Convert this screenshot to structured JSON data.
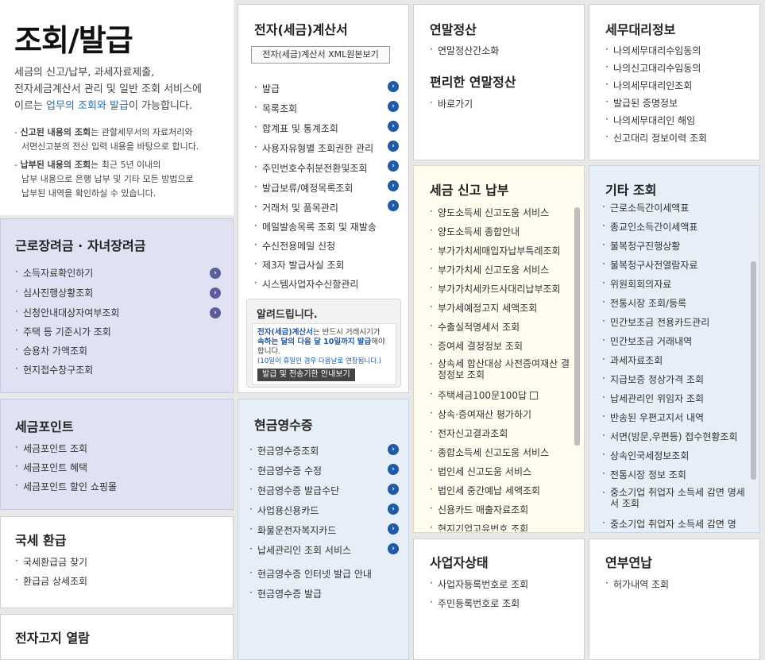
{
  "intro": {
    "title": "조회/발급",
    "desc_lines": [
      "세금의 신고/납부, 과세자료제출,",
      "전자세금계산서 관리 및 일반 조회 서비스에",
      "이르는 "
    ],
    "desc_link": "업무의 조회와 발급",
    "desc_tail": "이 가능합니다.",
    "note1_bold": "신고된 내용의 조회",
    "note1_rest": "는 관할세무서의 자료처리와",
    "note1_line2": "서면신고분의 전산 입력 내용을 바탕으로 합니다.",
    "note2_bold": "납부된 내용의 조회",
    "note2_rest": "는 최근 5년 이내의",
    "note2_line2": "납부 내용으로 은행 납부 및 기타 모든 방법으로",
    "note2_line3": "납부된 내역을 확인하실 수 있습니다."
  },
  "labor": {
    "title": "근로장려금 · 자녀장려금",
    "items": [
      "소득자료확인하기",
      "심사진행상황조회",
      "신청안내대상자여부조회",
      "주택 등 기준시가 조회",
      "승용차 가액조회",
      "현지접수창구조회"
    ]
  },
  "point": {
    "title": "세금포인트",
    "items": [
      "세금포인트 조회",
      "세금포인트 혜택",
      "세금포인트 할인 쇼핑몰"
    ]
  },
  "refund": {
    "title": "국세 환급",
    "items": [
      "국세환급금 찾기",
      "환급금 상세조회"
    ]
  },
  "notice": {
    "title": "전자고지 열람"
  },
  "invoice": {
    "title": "전자(세금)계산서",
    "xml_button": "전자(세금)계산서 XML원본보기",
    "items": [
      "발급",
      "목록조회",
      "합계표 및 통계조회",
      "사용자유형별 조회권한 관리",
      "주민번호수취분전환및조회",
      "발급보류/예정목록조회",
      "거래처 및 품목관리",
      "메일발송목록 조회 및 재발송",
      "수신전용메일 신청",
      "제3자 발급사실 조회",
      "시스템사업자수신함관리"
    ],
    "alert_title": "알려드립니다.",
    "alert_text1": "전자(세금)계산서",
    "alert_text2": "는 반드시 거래시기가",
    "alert_text3": "속하는 달의 다음 달 10일까지 발급",
    "alert_text4": "해야",
    "alert_text5": "합니다.",
    "alert_small": "(10일이 휴일인 경우 다음날로 연장됩니다.)",
    "alert_button": "발급 및 전송기한 안내보기"
  },
  "cash": {
    "title": "현금영수증",
    "items": [
      "현금영수증조회",
      "현금영수증 수정",
      "현금영수증 발급수단",
      "사업용신용카드",
      "화물운전자복지카드",
      "납세관리인 조회 서비스",
      "현금영수증 인터넷 발급 안내",
      "현금영수증 발급"
    ]
  },
  "yearend": {
    "title": "연말정산",
    "items": [
      "연말정산간소화"
    ],
    "title2": "편리한 연말정산",
    "items2": [
      "바로가기"
    ]
  },
  "taxfile": {
    "title": "세금 신고 납부",
    "items": [
      "양도소득세 신고도움 서비스",
      "양도소득세 종합안내",
      "부가가치세매입자납부특례조회",
      "부가가치세 신고도움 서비스",
      "부가가치세카드사대리납부조회",
      "부가세예정고지 세액조회",
      "수출실적명세서 조회",
      "증여세 결정정보 조회",
      "상속세 합산대상 사전증여재산 결정정보 조회",
      "주택세금100문100답",
      "상속·증여재산 평가하기",
      "전자신고결과조회",
      "종합소득세 신고도움 서비스",
      "법인세 신고도움 서비스",
      "법인세 중간예납 세액조회",
      "신용카드 매출자료조회",
      "현지기업고유번호 조회"
    ]
  },
  "biz": {
    "title": "사업자상태",
    "items": [
      "사업자등록번호로 조회",
      "주민등록번호로 조회"
    ]
  },
  "agent": {
    "title": "세무대리정보",
    "items": [
      "나의세무대리수임동의",
      "나의신고대리수임동의",
      "나의세무대리인조회",
      "발급된 증명정보",
      "나의세무대리인 해임",
      "신고대리 정보이력 조회"
    ]
  },
  "other": {
    "title": "기타 조회",
    "items": [
      "근로소득간이세액표",
      "종교인소득간이세액표",
      "불복청구진행상황",
      "불복청구사전열람자료",
      "위원회회의자료",
      "전통시장 조회/등록",
      "민간보조금 전용카드관리",
      "민간보조금 거래내역",
      "과세자료조회",
      "지급보증 정상가격 조회",
      "납세관리인 위임자 조회",
      "반송된 우편고지서 내역",
      "서면(방문,우편등) 접수현황조회",
      "상속인국세정보조회",
      "전통시장 정보 조회",
      "중소기업 취업자 소득세 감면 명세서 조회",
      "중소기업 취업자 소득세 감면 명"
    ]
  },
  "pension": {
    "title": "연부연납",
    "items": [
      "허가내역 조회"
    ]
  },
  "colors": {
    "purple_bg": "#e1e1f4",
    "blue_bg": "#e6eef7",
    "yellow_bg": "#fffdf0",
    "link": "#1a73c8"
  }
}
